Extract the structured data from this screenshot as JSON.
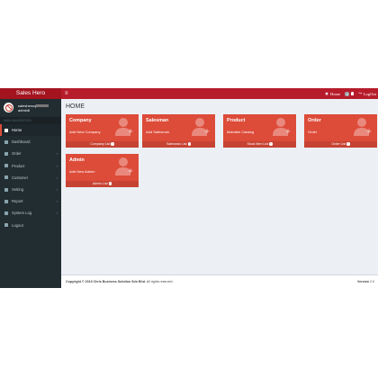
{
  "header": {
    "brand": "Sales Hero",
    "toggle_icon": "bars-icon",
    "home_label": "Home",
    "badge_count": "6",
    "logout_label": "LogOut"
  },
  "user": {
    "name_prefix": "salesherocj",
    "role": "admin6"
  },
  "sidebar": {
    "section_header": "MAIN NAVIGATION",
    "items": [
      {
        "label": "Home",
        "icon": "home-icon",
        "active": true,
        "chevron": false
      },
      {
        "label": "Dashboard",
        "icon": "dashboard-icon",
        "active": false,
        "chevron": false
      },
      {
        "label": "Order",
        "icon": "cart-icon",
        "active": false,
        "chevron": true
      },
      {
        "label": "Product",
        "icon": "cube-icon",
        "active": false,
        "chevron": true
      },
      {
        "label": "Customer",
        "icon": "users-icon",
        "active": false,
        "chevron": true
      },
      {
        "label": "Setting",
        "icon": "gear-icon",
        "active": false,
        "chevron": true
      },
      {
        "label": "Report",
        "icon": "report-icon",
        "active": false,
        "chevron": true
      },
      {
        "label": "System Log",
        "icon": "log-icon",
        "active": false,
        "chevron": true
      },
      {
        "label": "Logout",
        "icon": "signout-icon",
        "active": false,
        "chevron": false
      }
    ]
  },
  "main": {
    "title": "HOME",
    "cards": [
      {
        "title": "Company",
        "link": "Add New Company",
        "footer": "Company List"
      },
      {
        "title": "Salesman",
        "link": "Add Salesman",
        "footer": "Salesman List"
      },
      {
        "title": "Product",
        "link": "Maintain Catalog",
        "footer": "Stock Item List"
      },
      {
        "title": "Order",
        "link": "Order",
        "footer": "Order List"
      },
      {
        "title": "Admin",
        "link": "Add New Admin",
        "footer": "Admin List"
      }
    ]
  },
  "footer": {
    "copyright_bold": "Copyright © 2019 Chris Business Solution Sdn Bhd.",
    "copyright_rest": " All rights reserved.",
    "version_label": "Version",
    "version_value": "2.0"
  },
  "colors": {
    "topbar": "#b71c2b",
    "sidebar": "#222d32",
    "card": "#dd4b39",
    "card_footer": "#c64333"
  }
}
